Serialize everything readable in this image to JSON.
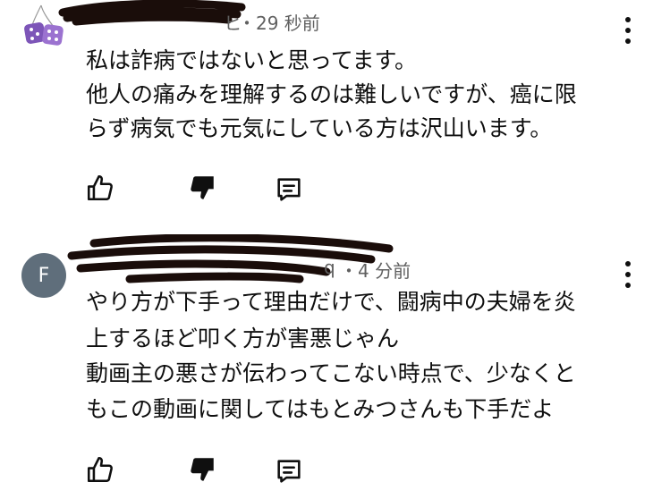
{
  "comments": [
    {
      "author": "",
      "time": "・29 秒前",
      "author_tail": "ヒ",
      "lines": [
        "私は詐病ではないと思ってます。",
        "他人の痛みを理解するのは難しいですが、癌に限",
        "らず病気でも元気にしている方は沢山います。"
      ],
      "avatar_icon": "dice-icon"
    },
    {
      "author": "",
      "author_tail": "q",
      "time": "・4 分前",
      "avatar_letter": "F",
      "lines": [
        "やり方が下手って理由だけで、闘病中の夫婦を炎",
        "上するほど叩く方が害悪じゃん",
        "動画主の悪さが伝わってこない時点で、少なくと",
        "もこの動画に関してはもとみつさんも下手だよ"
      ]
    }
  ],
  "icons": {
    "like": "thumb-up-icon",
    "dislike": "thumb-down-icon",
    "reply": "comment-reply-icon",
    "more": "more-vertical-icon"
  },
  "colors": {
    "text": "#0f0f0f",
    "meta": "#606060",
    "avatar_bg": "#5f6e7b",
    "dice": "#8a5fc2"
  }
}
